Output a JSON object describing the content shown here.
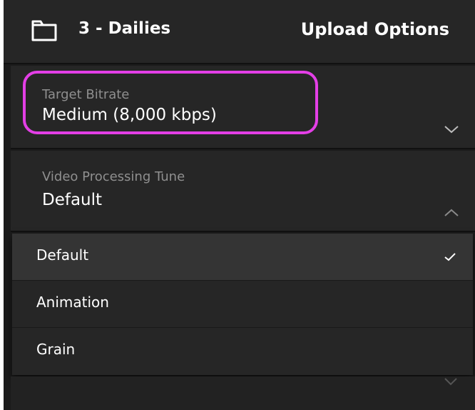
{
  "header": {
    "folder_name": "3 - Dailies",
    "panel_title": "Upload Options",
    "folder_icon": "folder-icon"
  },
  "fields": {
    "target_bitrate": {
      "label": "Target Bitrate",
      "value": "Medium (8,000 kbps)",
      "icon": "chevron-down-icon",
      "highlight_color": "#e33fe6"
    },
    "video_processing_tune": {
      "label": "Video Processing Tune",
      "value": "Default",
      "icon": "chevron-up-icon",
      "expanded": true
    }
  },
  "tune_menu": {
    "selected": "Default",
    "options": [
      {
        "label": "Default",
        "checked": true,
        "icon": "checkmark-icon"
      },
      {
        "label": "Animation",
        "checked": false
      },
      {
        "label": "Grain",
        "checked": false
      }
    ]
  },
  "colors": {
    "panel_background": "#1b1b1b",
    "row_background": "#262626",
    "selected_row": "#343434",
    "label_gray": "#8f8f8f",
    "text_white": "#ffffff",
    "highlight": "#e33fe6"
  }
}
